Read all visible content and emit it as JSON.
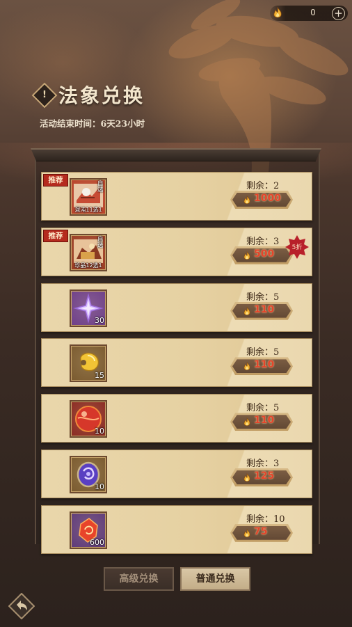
{
  "header": {
    "currency_value": "0",
    "currency_icon": "flame-icon",
    "add_icon": "plus-icon",
    "badge_glyph": "!",
    "title": "法象兑换",
    "end_time_label": "活动结束时间：",
    "end_time_value": "6天23小时"
  },
  "items": [
    {
      "recommended": "推荐",
      "icon": "chaos-select-box-icon",
      "label": "混沌11选1",
      "corner": "自选",
      "count": "",
      "remain_label": "剩余：",
      "remain": "2",
      "price": "1000",
      "discount": "",
      "icon_bg": "#b8412a"
    },
    {
      "recommended": "推荐",
      "icon": "treasure-select-box-icon",
      "label": "珍品12选1",
      "corner": "自选",
      "count": "",
      "remain_label": "剩余：",
      "remain": "3",
      "price": "500",
      "discount": "5折",
      "icon_bg": "#9b3b23"
    },
    {
      "recommended": "",
      "icon": "purple-star-icon",
      "label": "",
      "corner": "",
      "count": "30",
      "remain_label": "剩余：",
      "remain": "5",
      "price": "110",
      "discount": "",
      "icon_bg": "#6e3f8a"
    },
    {
      "recommended": "",
      "icon": "gold-gem-icon",
      "label": "",
      "corner": "",
      "count": "15",
      "remain_label": "剩余：",
      "remain": "5",
      "price": "110",
      "discount": "",
      "icon_bg": "#7a5a2f"
    },
    {
      "recommended": "",
      "icon": "red-orb-icon",
      "label": "",
      "corner": "",
      "count": "10",
      "remain_label": "剩余：",
      "remain": "5",
      "price": "110",
      "discount": "",
      "icon_bg": "#8a2a22"
    },
    {
      "recommended": "",
      "icon": "purple-seal-icon",
      "label": "",
      "corner": "",
      "count": "10",
      "remain_label": "剩余：",
      "remain": "3",
      "price": "125",
      "discount": "",
      "icon_bg": "#7a5a2f"
    },
    {
      "recommended": "",
      "icon": "red-crystal-icon",
      "label": "",
      "corner": "",
      "count": "600",
      "remain_label": "剩余：",
      "remain": "10",
      "price": "75",
      "discount": "",
      "icon_bg": "#5e3a7a"
    }
  ],
  "buttons": {
    "advanced": "高级兑换",
    "normal": "普通兑换"
  },
  "back_icon": "back-arrow-icon"
}
